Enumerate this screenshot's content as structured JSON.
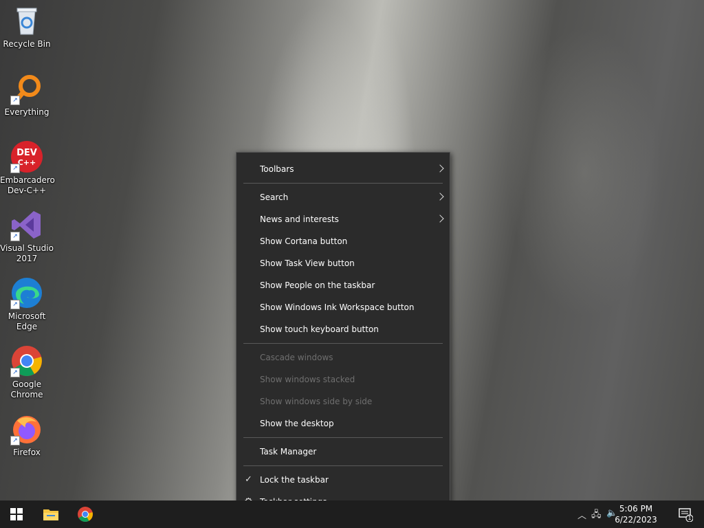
{
  "desktop": {
    "icons": [
      {
        "name": "recycle-bin",
        "label": "Recycle Bin"
      },
      {
        "name": "everything",
        "label": "Everything"
      },
      {
        "name": "dev-cpp",
        "label": "Embarcadero Dev-C++"
      },
      {
        "name": "visual-studio",
        "label": "Visual Studio 2017"
      },
      {
        "name": "edge",
        "label": "Microsoft Edge"
      },
      {
        "name": "chrome",
        "label": "Google Chrome"
      },
      {
        "name": "firefox",
        "label": "Firefox"
      }
    ]
  },
  "context_menu": {
    "items": {
      "toolbars": "Toolbars",
      "search": "Search",
      "news": "News and interests",
      "cortana": "Show Cortana button",
      "task_view": "Show Task View button",
      "people": "Show People on the taskbar",
      "ink": "Show Windows Ink Workspace button",
      "touch_keyboard": "Show touch keyboard button",
      "cascade": "Cascade windows",
      "stacked": "Show windows stacked",
      "side_by_side": "Show windows side by side",
      "show_desktop": "Show the desktop",
      "task_manager": "Task Manager",
      "lock": "Lock the taskbar",
      "settings": "Taskbar settings"
    },
    "lock_checked": true
  },
  "taskbar": {
    "clock_time": "5:06 PM",
    "clock_date": "6/22/2023",
    "notification_count": "1"
  }
}
